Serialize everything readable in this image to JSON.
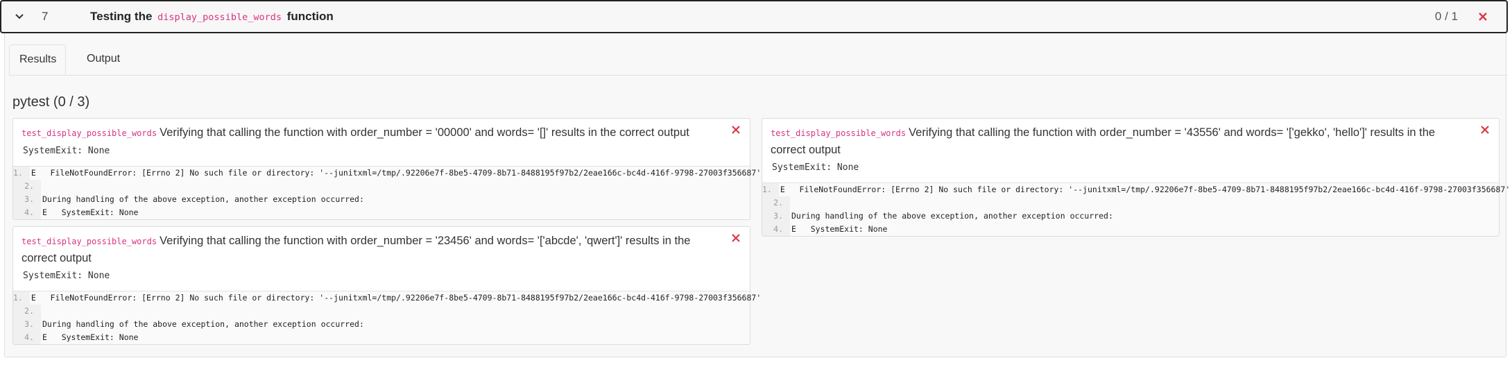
{
  "task": {
    "number": "7",
    "title_prefix": "Testing the",
    "title_code": "display_possible_words",
    "title_suffix": "function",
    "score": "0 / 1"
  },
  "tabs": [
    "Results",
    "Output"
  ],
  "suite": {
    "title": "pytest (0 / 3)"
  },
  "tests": [
    {
      "name": "test_display_possible_words",
      "description": "Verifying that calling the function with order_number = '00000' and words= '[]' results in the correct output",
      "exit": "SystemExit: None",
      "lines": [
        {
          "n": "1.",
          "t": "E   FileNotFoundError: [Errno 2] No such file or directory: '--junitxml=/tmp/.92206e7f-8be5-4709-8b71-8488195f97b2/2eae166c-bc4d-416f-9798-27003f356687'"
        },
        {
          "n": "2.",
          "t": ""
        },
        {
          "n": "3.",
          "t": "During handling of the above exception, another exception occurred:"
        },
        {
          "n": "4.",
          "t": "E   SystemExit: None"
        }
      ]
    },
    {
      "name": "test_display_possible_words",
      "description": "Verifying that calling the function with order_number = '23456' and words= '['abcde', 'qwert']' results in the correct output",
      "exit": "SystemExit: None",
      "lines": [
        {
          "n": "1.",
          "t": "E   FileNotFoundError: [Errno 2] No such file or directory: '--junitxml=/tmp/.92206e7f-8be5-4709-8b71-8488195f97b2/2eae166c-bc4d-416f-9798-27003f356687'"
        },
        {
          "n": "2.",
          "t": ""
        },
        {
          "n": "3.",
          "t": "During handling of the above exception, another exception occurred:"
        },
        {
          "n": "4.",
          "t": "E   SystemExit: None"
        }
      ]
    },
    {
      "name": "test_display_possible_words",
      "description": "Verifying that calling the function with order_number = '43556' and words= '['gekko', 'hello']' results in the correct output",
      "exit": "SystemExit: None",
      "lines": [
        {
          "n": "1.",
          "t": "E   FileNotFoundError: [Errno 2] No such file or directory: '--junitxml=/tmp/.92206e7f-8be5-4709-8b71-8488195f97b2/2eae166c-bc4d-416f-9798-27003f356687'"
        },
        {
          "n": "2.",
          "t": ""
        },
        {
          "n": "3.",
          "t": "During handling of the above exception, another exception occurred:"
        },
        {
          "n": "4.",
          "t": "E   SystemExit: None"
        }
      ]
    }
  ],
  "icons": {
    "collapse": "chevron-down-icon",
    "fail": "close-icon"
  },
  "colors": {
    "fail": "#dc3545",
    "code": "#d63384"
  }
}
